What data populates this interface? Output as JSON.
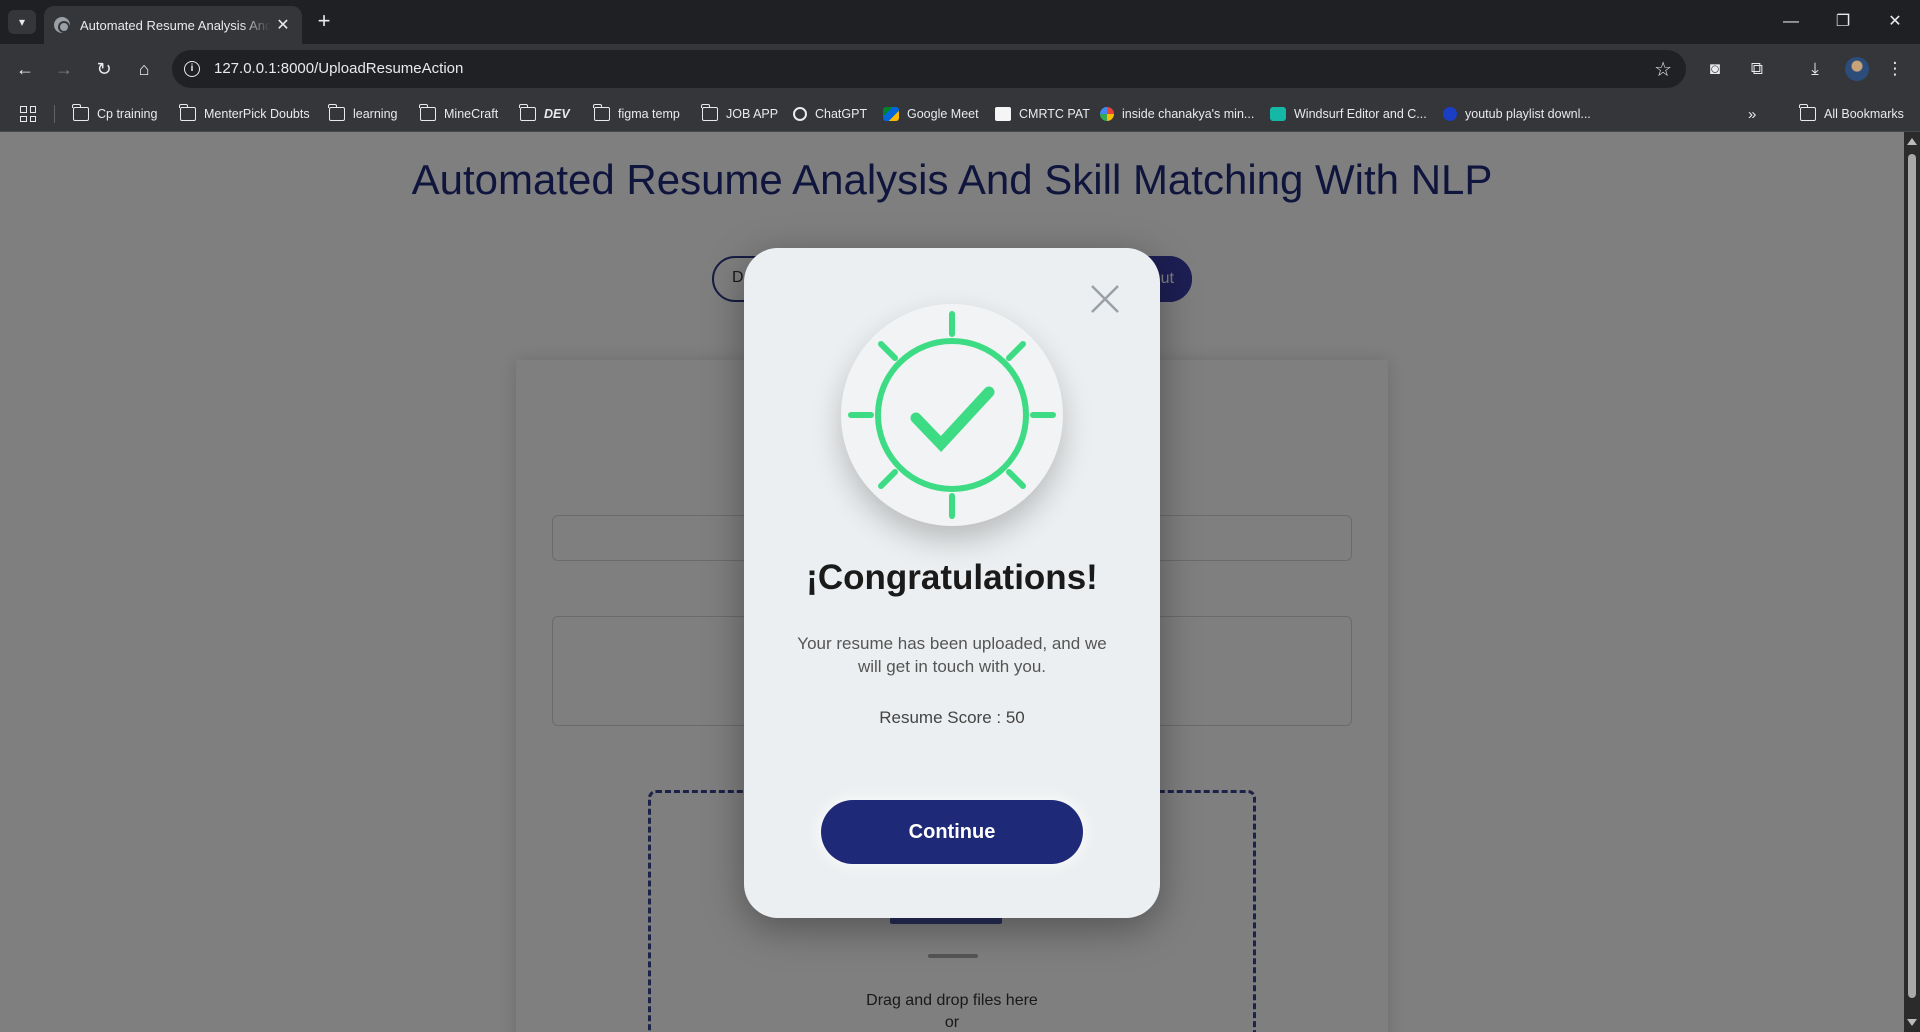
{
  "browser": {
    "tab_title": "Automated Resume Analysis And Skill Matching With NLP",
    "url": "127.0.0.1:8000/UploadResumeAction",
    "bookmarks": [
      {
        "label": "Cp training",
        "icon": "folder-icon"
      },
      {
        "label": "MenterPick Doubts",
        "icon": "folder-icon"
      },
      {
        "label": "learning",
        "icon": "folder-icon"
      },
      {
        "label": "MineCraft",
        "icon": "folder-icon"
      },
      {
        "label": "DEV",
        "icon": "folder-icon"
      },
      {
        "label": "figma temp",
        "icon": "folder-icon"
      },
      {
        "label": "JOB APP",
        "icon": "folder-icon"
      },
      {
        "label": "ChatGPT",
        "icon": "chatgpt-icon"
      },
      {
        "label": "Google Meet",
        "icon": "google-meet-icon"
      },
      {
        "label": "CMRTC PAT",
        "icon": "pat-icon"
      },
      {
        "label": "inside chanakya's min...",
        "icon": "google-icon"
      },
      {
        "label": "Windsurf Editor and C...",
        "icon": "windsurf-icon"
      },
      {
        "label": "youtub playlist downl...",
        "icon": "info-icon"
      }
    ],
    "all_bookmarks": "All Bookmarks"
  },
  "page": {
    "title": "Automated Resume Analysis And Skill Matching With NLP",
    "nav_left": "D",
    "nav_right": "ut",
    "dropzone_text": "Drag and drop files here",
    "dropzone_or": "or"
  },
  "modal": {
    "title": "¡Congratulations!",
    "message": "Your resume has been uploaded, and we will get in touch with you.",
    "score": "Resume Score : 50",
    "continue_label": "Continue",
    "accent_color": "#3ddc84",
    "button_color": "#1e2a78"
  }
}
